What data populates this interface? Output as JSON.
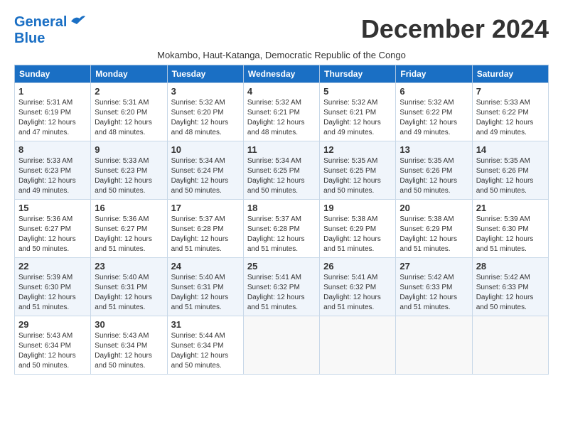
{
  "logo": {
    "line1": "General",
    "line2": "Blue"
  },
  "title": "December 2024",
  "subtitle": "Mokambo, Haut-Katanga, Democratic Republic of the Congo",
  "headers": [
    "Sunday",
    "Monday",
    "Tuesday",
    "Wednesday",
    "Thursday",
    "Friday",
    "Saturday"
  ],
  "weeks": [
    [
      {
        "day": "1",
        "rise": "5:31 AM",
        "set": "6:19 PM",
        "daylight": "12 hours and 47 minutes."
      },
      {
        "day": "2",
        "rise": "5:31 AM",
        "set": "6:20 PM",
        "daylight": "12 hours and 48 minutes."
      },
      {
        "day": "3",
        "rise": "5:32 AM",
        "set": "6:20 PM",
        "daylight": "12 hours and 48 minutes."
      },
      {
        "day": "4",
        "rise": "5:32 AM",
        "set": "6:21 PM",
        "daylight": "12 hours and 48 minutes."
      },
      {
        "day": "5",
        "rise": "5:32 AM",
        "set": "6:21 PM",
        "daylight": "12 hours and 49 minutes."
      },
      {
        "day": "6",
        "rise": "5:32 AM",
        "set": "6:22 PM",
        "daylight": "12 hours and 49 minutes."
      },
      {
        "day": "7",
        "rise": "5:33 AM",
        "set": "6:22 PM",
        "daylight": "12 hours and 49 minutes."
      }
    ],
    [
      {
        "day": "8",
        "rise": "5:33 AM",
        "set": "6:23 PM",
        "daylight": "12 hours and 49 minutes."
      },
      {
        "day": "9",
        "rise": "5:33 AM",
        "set": "6:23 PM",
        "daylight": "12 hours and 50 minutes."
      },
      {
        "day": "10",
        "rise": "5:34 AM",
        "set": "6:24 PM",
        "daylight": "12 hours and 50 minutes."
      },
      {
        "day": "11",
        "rise": "5:34 AM",
        "set": "6:25 PM",
        "daylight": "12 hours and 50 minutes."
      },
      {
        "day": "12",
        "rise": "5:35 AM",
        "set": "6:25 PM",
        "daylight": "12 hours and 50 minutes."
      },
      {
        "day": "13",
        "rise": "5:35 AM",
        "set": "6:26 PM",
        "daylight": "12 hours and 50 minutes."
      },
      {
        "day": "14",
        "rise": "5:35 AM",
        "set": "6:26 PM",
        "daylight": "12 hours and 50 minutes."
      }
    ],
    [
      {
        "day": "15",
        "rise": "5:36 AM",
        "set": "6:27 PM",
        "daylight": "12 hours and 50 minutes."
      },
      {
        "day": "16",
        "rise": "5:36 AM",
        "set": "6:27 PM",
        "daylight": "12 hours and 51 minutes."
      },
      {
        "day": "17",
        "rise": "5:37 AM",
        "set": "6:28 PM",
        "daylight": "12 hours and 51 minutes."
      },
      {
        "day": "18",
        "rise": "5:37 AM",
        "set": "6:28 PM",
        "daylight": "12 hours and 51 minutes."
      },
      {
        "day": "19",
        "rise": "5:38 AM",
        "set": "6:29 PM",
        "daylight": "12 hours and 51 minutes."
      },
      {
        "day": "20",
        "rise": "5:38 AM",
        "set": "6:29 PM",
        "daylight": "12 hours and 51 minutes."
      },
      {
        "day": "21",
        "rise": "5:39 AM",
        "set": "6:30 PM",
        "daylight": "12 hours and 51 minutes."
      }
    ],
    [
      {
        "day": "22",
        "rise": "5:39 AM",
        "set": "6:30 PM",
        "daylight": "12 hours and 51 minutes."
      },
      {
        "day": "23",
        "rise": "5:40 AM",
        "set": "6:31 PM",
        "daylight": "12 hours and 51 minutes."
      },
      {
        "day": "24",
        "rise": "5:40 AM",
        "set": "6:31 PM",
        "daylight": "12 hours and 51 minutes."
      },
      {
        "day": "25",
        "rise": "5:41 AM",
        "set": "6:32 PM",
        "daylight": "12 hours and 51 minutes."
      },
      {
        "day": "26",
        "rise": "5:41 AM",
        "set": "6:32 PM",
        "daylight": "12 hours and 51 minutes."
      },
      {
        "day": "27",
        "rise": "5:42 AM",
        "set": "6:33 PM",
        "daylight": "12 hours and 51 minutes."
      },
      {
        "day": "28",
        "rise": "5:42 AM",
        "set": "6:33 PM",
        "daylight": "12 hours and 50 minutes."
      }
    ],
    [
      {
        "day": "29",
        "rise": "5:43 AM",
        "set": "6:34 PM",
        "daylight": "12 hours and 50 minutes."
      },
      {
        "day": "30",
        "rise": "5:43 AM",
        "set": "6:34 PM",
        "daylight": "12 hours and 50 minutes."
      },
      {
        "day": "31",
        "rise": "5:44 AM",
        "set": "6:34 PM",
        "daylight": "12 hours and 50 minutes."
      },
      null,
      null,
      null,
      null
    ]
  ]
}
